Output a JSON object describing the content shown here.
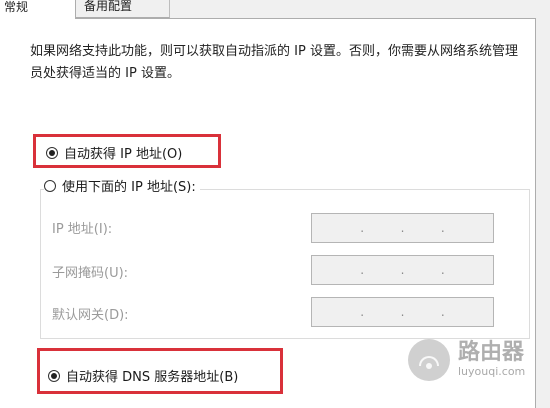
{
  "tabs": [
    {
      "label": "常规"
    },
    {
      "label": "备用配置"
    }
  ],
  "description": "如果网络支持此功能，则可以获取自动指派的 IP 设置。否则，你需要从网络系统管理员处获得适当的 IP 设置。",
  "ip_options": {
    "auto": {
      "label": "自动获得 IP 地址(O)",
      "checked": true
    },
    "manual": {
      "label": "使用下面的 IP 地址(S):",
      "checked": false
    }
  },
  "fields": [
    {
      "label": "IP 地址(I):",
      "value": ".    .    ."
    },
    {
      "label": "子网掩码(U):",
      "value": ".    .    ."
    },
    {
      "label": "默认网关(D):",
      "value": ".    .    ."
    }
  ],
  "dns_options": {
    "auto": {
      "label": "自动获得 DNS 服务器地址(B)",
      "checked": true
    }
  },
  "watermark": {
    "title": "路由器",
    "url": "luyouqi.com"
  },
  "colors": {
    "highlight": "#d9313a"
  }
}
